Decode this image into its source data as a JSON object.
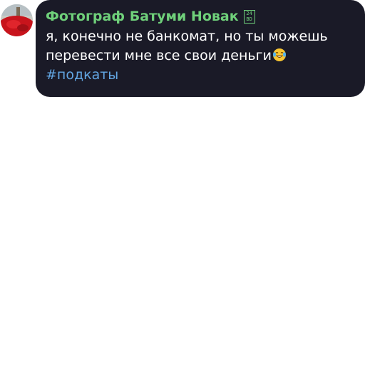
{
  "message": {
    "sender_name": "Фотограф Батуми Новак",
    "sender_badge_top": "24",
    "sender_badge_bottom": "BD",
    "text_line_1": "я, конечно не банкомат, но ты можешь",
    "text_line_2": "перевести мне все свои деньги",
    "emoji_icon": "face-with-tears-of-joy-icon",
    "hashtag": "#подкаты"
  },
  "colors": {
    "bubble_bg": "#1a1a27",
    "sender_name": "#6fd07a",
    "message_text": "#ffffff",
    "hashtag": "#62a6e3"
  }
}
